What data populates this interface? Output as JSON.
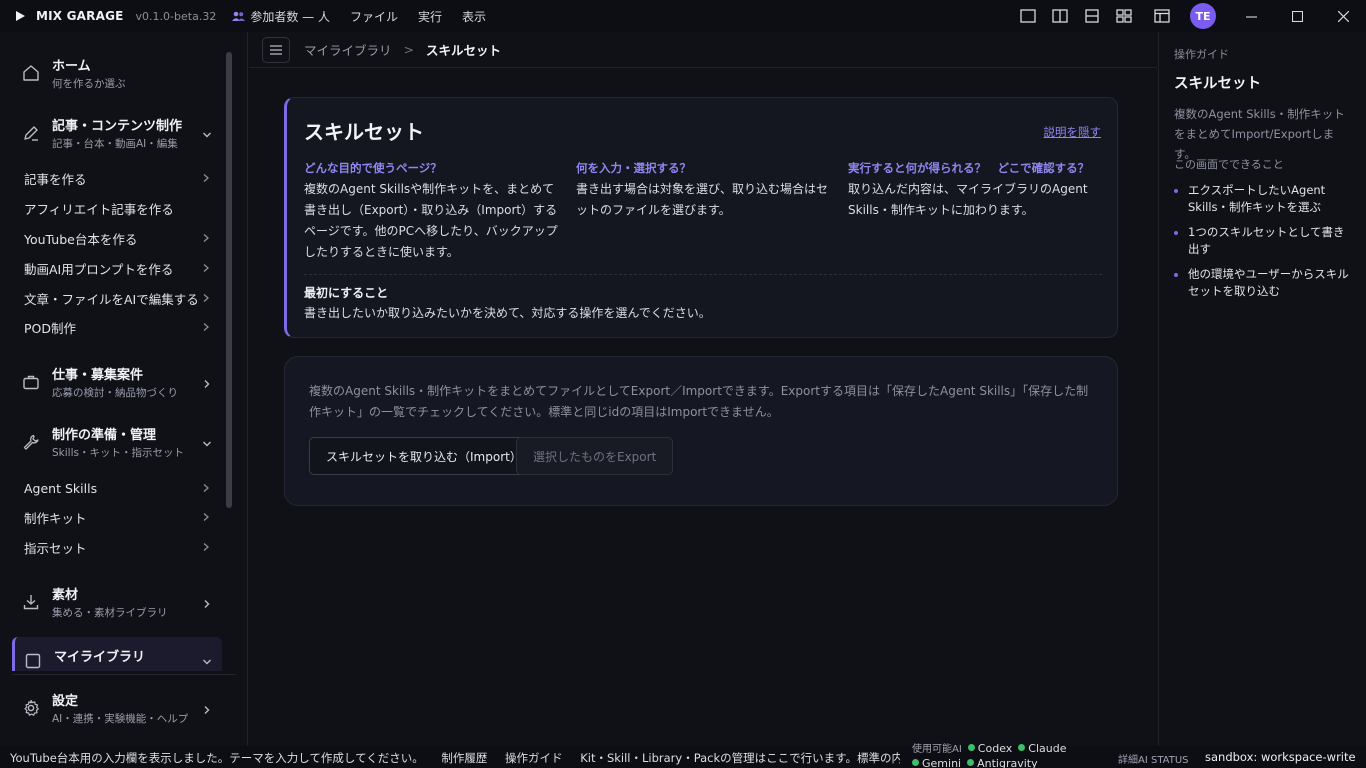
{
  "titlebar": {
    "app_name": "MIX GARAGE",
    "version": "v0.1.0-beta.32",
    "participants": "参加者数 — 人",
    "menus": [
      "ファイル",
      "実行",
      "表示"
    ],
    "avatar": "TE"
  },
  "sidebar": {
    "groups": [
      {
        "title": "ホーム",
        "sub": "何を作るか選ぶ"
      },
      {
        "title": "記事・コンテンツ制作",
        "sub": "記事・台本・動画AI・編集"
      },
      {
        "title": "仕事・募集案件",
        "sub": "応募の検討・納品物づくり"
      },
      {
        "title": "制作の準備・管理",
        "sub": "Skills・キット・指示セット"
      },
      {
        "title": "素材",
        "sub": "集める・素材ライブラリ"
      },
      {
        "title": "マイライブラリ"
      },
      {
        "title": "設定",
        "sub": "AI・連携・実験機能・ヘルプ"
      }
    ],
    "content_items": [
      "記事を作る",
      "アフィリエイト記事を作る",
      "YouTube台本を作る",
      "動画AI用プロンプトを作る",
      "文章・ファイルをAIで編集する",
      "POD制作"
    ],
    "prep_items": [
      "Agent Skills",
      "制作キット",
      "指示セット"
    ]
  },
  "breadcrumb": {
    "parent": "マイライブラリ",
    "separator": ">",
    "current": "スキルセット"
  },
  "info_card": {
    "title": "スキルセット",
    "hide_link": "説明を隠す",
    "columns": [
      {
        "heading": "どんな目的で使うページ？",
        "body": "複数のAgent Skillsや制作キットを、まとめて書き出し（Export）・取り込み（Import）するページです。他のPCへ移したり、バックアップしたりするときに使います。"
      },
      {
        "heading": "何を入力・選択する？",
        "body": "書き出す場合は対象を選び、取り込む場合はセットのファイルを選びます。"
      },
      {
        "heading": "実行すると何が得られる？　どこで確認する？",
        "body": "取り込んだ内容は、マイライブラリのAgent Skills・制作キットに加わります。"
      }
    ],
    "first_heading": "最初にすること",
    "first_body": "書き出したいか取り込みたいかを決めて、対応する操作を選んでください。"
  },
  "action_card": {
    "description": "複数のAgent Skills・制作キットをまとめてファイルとしてExport／Importできます。Exportする項目は「保存したAgent Skills」「保存した制作キット」の一覧でチェックしてください。標準と同じidの項目はImportできません。",
    "import_label": "スキルセットを取り込む（Import）",
    "export_label": "選択したものをExport"
  },
  "guide": {
    "header": "操作ガイド",
    "title": "スキルセット",
    "description": "複数のAgent Skills・制作キットをまとめてImport/Exportします。",
    "subheading": "この画面でできること",
    "items": [
      "エクスポートしたいAgent Skills・制作キットを選ぶ",
      "1つのスキルセットとして書き出す",
      "他の環境やユーザーからスキルセットを取り込む"
    ]
  },
  "statusbar": {
    "message": "YouTube台本用の入力欄を表示しました。テーマを入力して作成してください。",
    "history": "制作履歴",
    "guide": "操作ガイド",
    "note": "Kit・Skill・Library・Packの管理はここで行います。標準の内容は編集できません（複製して編集してください）",
    "ai_label": "使用可能AI",
    "ai_list": [
      "Codex",
      "Claude",
      "Gemini",
      "Antigravity"
    ],
    "detail": "詳細AI STATUS",
    "sandbox": "sandbox: workspace-write"
  },
  "colors": {
    "accent": "#7c6ae6",
    "link": "#8f86f0",
    "ok": "#3cbf6a",
    "avatar": "#7a5cf0"
  }
}
